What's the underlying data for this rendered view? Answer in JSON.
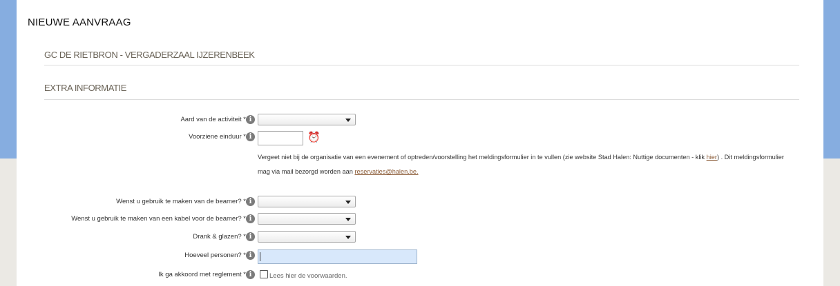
{
  "page": {
    "title": "NIEUWE AANVRAAG"
  },
  "location": {
    "heading": "GC DE RIETBRON  - VERGADERZAAL IJZERENBEEK"
  },
  "extra": {
    "heading": "EXTRA INFORMATIE"
  },
  "fields": {
    "activity_type": {
      "label": "Aard van de activiteit *",
      "value": ""
    },
    "end_time": {
      "label": "Voorziene einduur *",
      "value": ""
    },
    "beamer": {
      "label": "Wenst u gebruik te maken van de beamer? *",
      "value": ""
    },
    "beamer_cable": {
      "label": "Wenst u gebruik te maken van een kabel voor de beamer? *",
      "value": ""
    },
    "drinks": {
      "label": "Drank & glazen? *",
      "value": ""
    },
    "persons": {
      "label": "Hoeveel personen? *",
      "value": ""
    },
    "agree": {
      "label": "Ik ga akkoord met reglement *",
      "check_label": "Lees hier de voorwaarden.",
      "checked": false
    }
  },
  "notice": {
    "text_1": "Vergeet niet bij de organisatie van een evenement of optreden/voorstelling het meldingsformulier in te vullen (zie website Stad Halen: Nuttige documenten - klik ",
    "link_1": "hier",
    "text_2": ") . Dit meldingsformulier mag via mail bezorgd worden aan ",
    "link_2": "reservaties@halen.be."
  },
  "icons": {
    "info": "info-icon",
    "clock": "alarm-clock-icon",
    "dropdown": "caret-down-icon"
  },
  "colors": {
    "sidebar_accent": "#86ade0",
    "active_input": "#d8e8fb",
    "link": "#8a5a35"
  }
}
